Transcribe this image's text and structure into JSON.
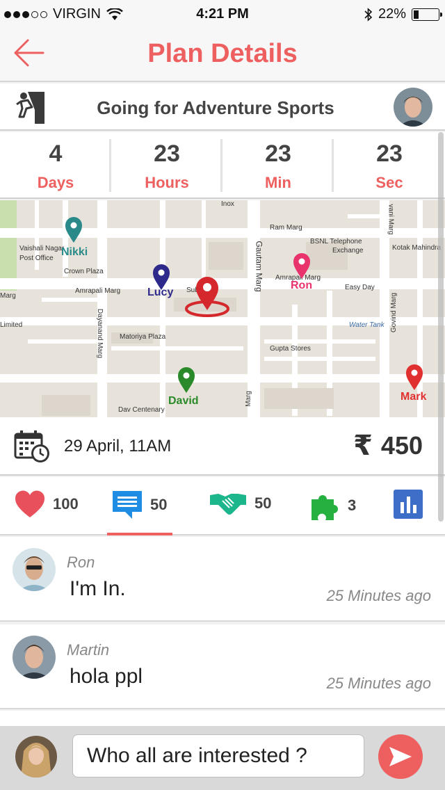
{
  "status_bar": {
    "carrier": "VIRGIN",
    "time": "4:21 PM",
    "battery": "22%",
    "battery_level": 0.22
  },
  "header": {
    "title": "Plan Details"
  },
  "plan": {
    "title": "Going for Adventure Sports"
  },
  "countdown": [
    {
      "value": "4",
      "label": "Days"
    },
    {
      "value": "23",
      "label": "Hours"
    },
    {
      "value": "23",
      "label": "Min"
    },
    {
      "value": "23",
      "label": "Sec"
    }
  ],
  "map": {
    "places": [
      "Inox",
      "Ram Marg",
      "BSNL Telephone",
      "Exchange",
      "Kotak Mahindra",
      "Vaishali Nagar",
      "Post Office",
      "Crown Plaza",
      "Amrapali Marg",
      "Amrapali Marg",
      "Easy Day",
      "Water Tank",
      "Matoriya Plaza",
      "Gupta Stores",
      "Dav Centenary",
      "Limited",
      "Marg",
      "Sub",
      "Gautam Marg",
      "Dayanand Marg",
      "Govind Marg",
      "vani Marg",
      "Marg"
    ],
    "pins": [
      {
        "name": "Nikki",
        "color": "#2a8a8a"
      },
      {
        "name": "Lucy",
        "color": "#2e2a8c"
      },
      {
        "name": "Ron",
        "color": "#e8336d"
      },
      {
        "name": "David",
        "color": "#2a8a2a"
      },
      {
        "name": "Mark",
        "color": "#e03030"
      }
    ]
  },
  "event": {
    "date": "29 April, 11AM",
    "currency_symbol": "₹",
    "price": "450"
  },
  "stats": {
    "likes": "100",
    "comments": "50",
    "joins": "50",
    "puzzles": "3"
  },
  "comments": [
    {
      "name": "Ron",
      "message": "I'm In.",
      "time": "25 Minutes ago"
    },
    {
      "name": "Martin",
      "message": "hola ppl",
      "time": "25 Minutes ago"
    }
  ],
  "composer": {
    "value": "Who all are interested ?"
  },
  "colors": {
    "accent": "#ee5f5f",
    "heart": "#e8505b",
    "chat": "#1f8de3",
    "handshake": "#1bb68c",
    "puzzle": "#26b040",
    "chart": "#3d6fc9"
  }
}
